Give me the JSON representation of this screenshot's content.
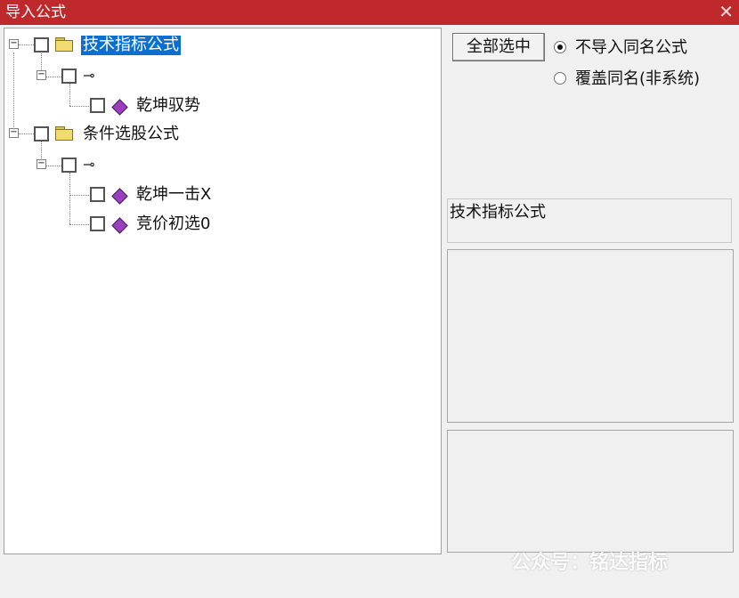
{
  "window": {
    "title": "导入公式",
    "close_glyph": "✕"
  },
  "tree": {
    "groups": [
      {
        "label": "技术指标公式",
        "selected": true,
        "sub_label": "",
        "items": [
          "乾坤驭势"
        ]
      },
      {
        "label": "条件选股公式",
        "selected": false,
        "sub_label": "",
        "items": [
          "乾坤一击X",
          "竞价初选0"
        ]
      }
    ],
    "expand_glyph": "−"
  },
  "right": {
    "select_all_label": "全部选中",
    "options": [
      {
        "label": "不导入同名公式",
        "checked": true
      },
      {
        "label": "覆盖同名(非系统)",
        "checked": false
      }
    ],
    "info_label": "技术指标公式"
  },
  "watermark": "公众号：铭达指标",
  "colors": {
    "titlebar": "#c0292b",
    "selection": "#0a6fd1",
    "formula_gem": "#9b3fbf",
    "folder": "#f3dc6f"
  },
  "icons": {
    "group": "folder-icon",
    "subgroup": "key-icon",
    "formula": "gem-icon",
    "close": "close-icon"
  }
}
